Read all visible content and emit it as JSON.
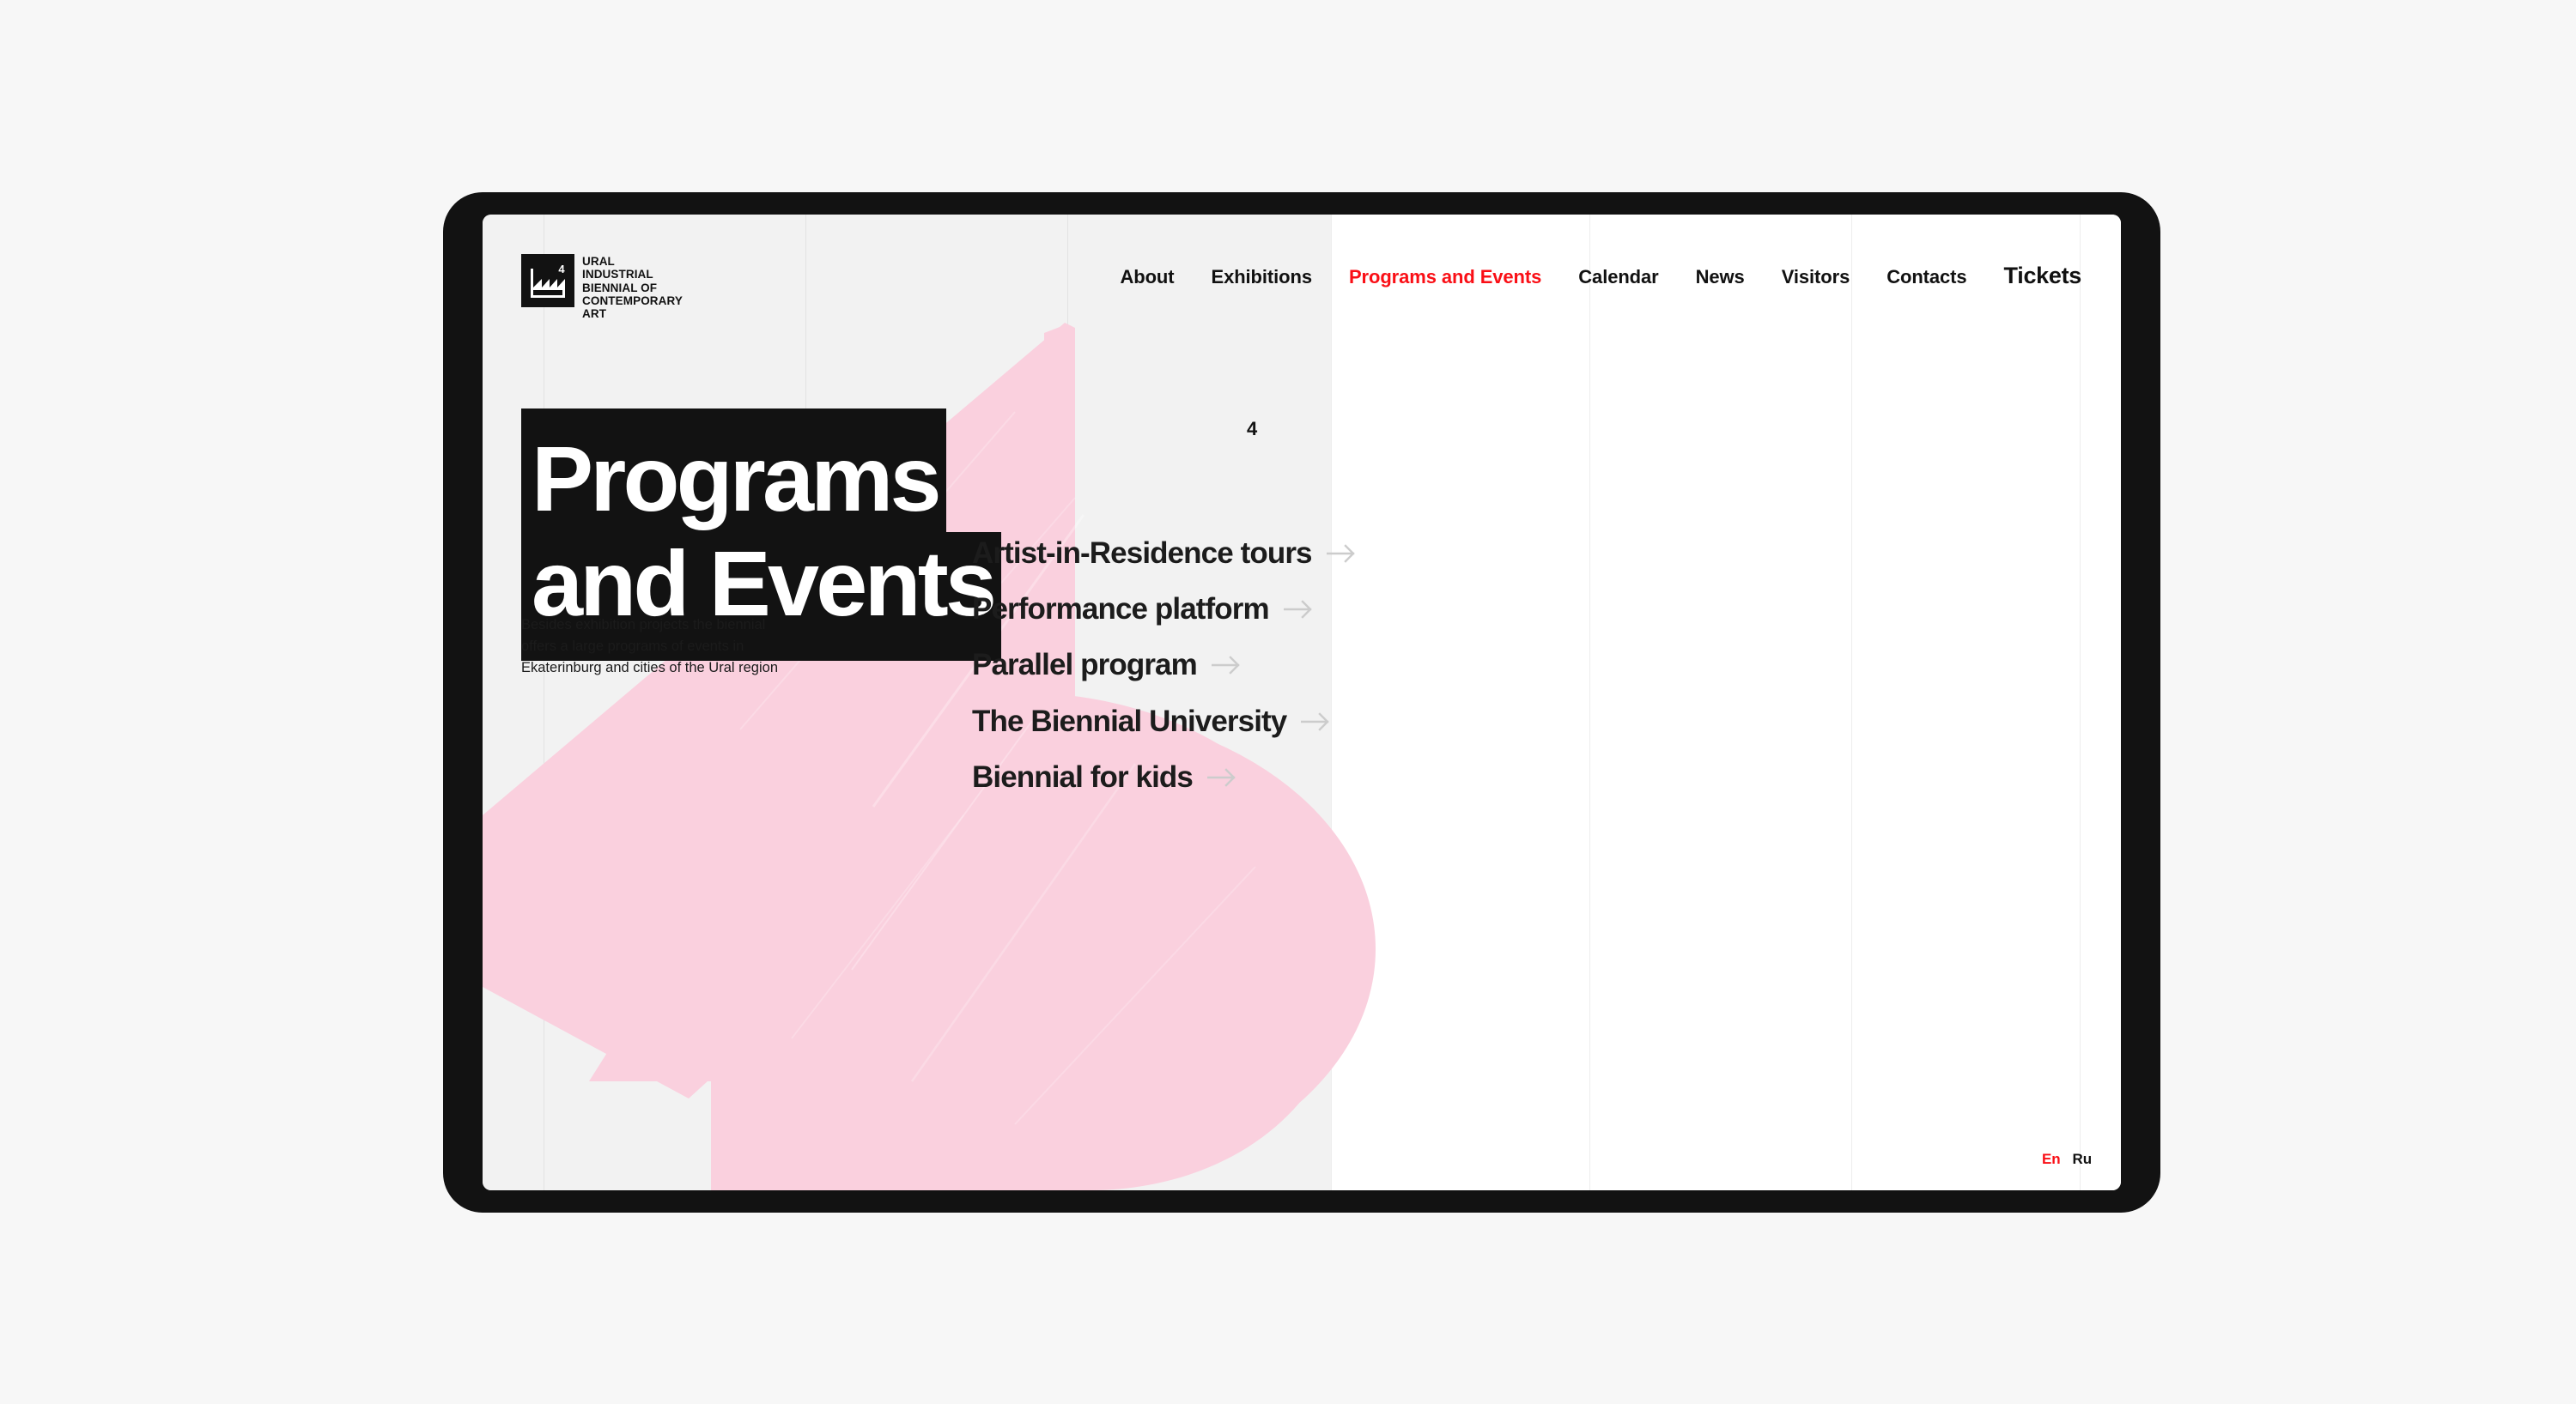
{
  "colors": {
    "page_background": "#f7f7f7",
    "device_frame": "#121212",
    "screen_left_panel": "#f2f2f2",
    "screen_right_panel": "#ffffff",
    "accent_red": "#fa0f16",
    "highlight_black": "#121212",
    "brush_pink": "#fad0de",
    "grid_line": "#e3e3e3",
    "arrow_gray": "#cccccc"
  },
  "header": {
    "logo": {
      "icon": "factory-logo-icon",
      "badge_number": "4",
      "wordmark": "URAL\nINDUSTRIAL\nBIENNIAL OF\nCONTEMPORARY\nART"
    },
    "nav": [
      {
        "label": "About",
        "active": false,
        "emphasis": false
      },
      {
        "label": "Exhibitions",
        "active": false,
        "emphasis": false
      },
      {
        "label": "Programs and Events",
        "active": true,
        "emphasis": false
      },
      {
        "label": "Calendar",
        "active": false,
        "emphasis": false
      },
      {
        "label": "News",
        "active": false,
        "emphasis": false
      },
      {
        "label": "Visitors",
        "active": false,
        "emphasis": false
      },
      {
        "label": "Contacts",
        "active": false,
        "emphasis": false
      },
      {
        "label": "Tickets",
        "active": false,
        "emphasis": true
      }
    ]
  },
  "hero": {
    "title_line_1": "Programs",
    "title_line_2": "and Events",
    "superscript": "4",
    "description": "Besides exhibition projects the biennial offers a large programs of events in Ekaterinburg and cities of the Ural region"
  },
  "program_menu": {
    "arrow_icon": "arrow-right-icon",
    "items": [
      {
        "label": "Artist-in-Residence tours"
      },
      {
        "label": "Performance platform"
      },
      {
        "label": "Parallel program"
      },
      {
        "label": "The Biennial University"
      },
      {
        "label": "Biennial for kids"
      }
    ]
  },
  "language_switcher": {
    "options": [
      {
        "label": "En",
        "active": true
      },
      {
        "label": "Ru",
        "active": false
      }
    ]
  }
}
